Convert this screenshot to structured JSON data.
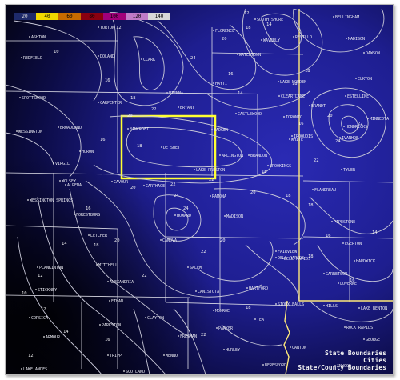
{
  "legend": {
    "ticks": [
      "20",
      "40",
      "60",
      "80",
      "100",
      "120",
      "140"
    ],
    "colors": [
      "#1e2a6a",
      "#f0d800",
      "#c86a00",
      "#8a0010",
      "#a0007a",
      "#c07cc8",
      "#d8d8d8"
    ]
  },
  "map": {
    "background_gradient": [
      "#050510",
      "#0a0a3a",
      "#1d1d8c",
      "#2a2ab0"
    ],
    "contour_color": "#c8c8d8",
    "county_line_color": "#e6e6e6",
    "state_line_color": "#ffe97a",
    "highlight_box_color": "#ffff33"
  },
  "places": [
    {
      "name": "TURTON"
    },
    {
      "name": "ASHTON"
    },
    {
      "name": "REDFIELD"
    },
    {
      "name": "DOLAND"
    },
    {
      "name": "CLARK"
    },
    {
      "name": "FLORENCE"
    },
    {
      "name": "SOUTH SHORE"
    },
    {
      "name": "WAVERLY"
    },
    {
      "name": "REVILLO"
    },
    {
      "name": "BELLINGHAM"
    },
    {
      "name": "MADISON"
    },
    {
      "name": "DAWSON"
    },
    {
      "name": "WATERTOWN"
    },
    {
      "name": "LAKE NORDEN"
    },
    {
      "name": "CARPENTER"
    },
    {
      "name": "BRYANT"
    },
    {
      "name": "VIENNA"
    },
    {
      "name": "HAYTI"
    },
    {
      "name": "CASTLEWOOD"
    },
    {
      "name": "CLEAR LAKE"
    },
    {
      "name": "BRANDT"
    },
    {
      "name": "TORONTO"
    },
    {
      "name": "ESTELLINE"
    },
    {
      "name": "HENDRICKS"
    },
    {
      "name": "MINNEOTA"
    },
    {
      "name": "IVANHOE"
    },
    {
      "name": "TYLER"
    },
    {
      "name": "SPOTTSWOOD"
    },
    {
      "name": "WESSINGTON"
    },
    {
      "name": "BROADLAND"
    },
    {
      "name": "HURON"
    },
    {
      "name": "VIRGIL"
    },
    {
      "name": "BANCROFT"
    },
    {
      "name": "DE SMET"
    },
    {
      "name": "BADGER"
    },
    {
      "name": "ARLINGTON"
    },
    {
      "name": "WHITE"
    },
    {
      "name": "BROOKINGS"
    },
    {
      "name": "IROQUOIS"
    },
    {
      "name": "LAKE PRESTON"
    },
    {
      "name": "WOLSEY"
    },
    {
      "name": "CAVOUR"
    },
    {
      "name": "ALPENA"
    },
    {
      "name": "WESSINGTON SPRINGS"
    },
    {
      "name": "FORESTBURG"
    },
    {
      "name": "CARTHAGE"
    },
    {
      "name": "RAMONA"
    },
    {
      "name": "HOWARD"
    },
    {
      "name": "MADISON"
    },
    {
      "name": "FLANDREAU"
    },
    {
      "name": "PIPESTONE"
    },
    {
      "name": "LETCHER"
    },
    {
      "name": "CANOVA"
    },
    {
      "name": "EGERTON"
    },
    {
      "name": "FAIRVIEW"
    },
    {
      "name": "HARDWICK"
    },
    {
      "name": "PLANKINTON"
    },
    {
      "name": "MITCHELL"
    },
    {
      "name": "SALEM"
    },
    {
      "name": "DELL RAPIDS"
    },
    {
      "name": "GARRETSON"
    },
    {
      "name": "LUVERNE"
    },
    {
      "name": "STICKNEY"
    },
    {
      "name": "ALEXANDRIA"
    },
    {
      "name": "CANISTOTA"
    },
    {
      "name": "HARTFORD"
    },
    {
      "name": "SIOUX FALLS"
    },
    {
      "name": "ETHAN"
    },
    {
      "name": "MONROE"
    },
    {
      "name": "CORSICA"
    },
    {
      "name": "ARMOUR"
    },
    {
      "name": "PARKSTON"
    },
    {
      "name": "CLAYTON"
    },
    {
      "name": "PARKER"
    },
    {
      "name": "TEA"
    },
    {
      "name": "ROCK RAPIDS"
    },
    {
      "name": "GEORGE"
    },
    {
      "name": "FREEMAN"
    },
    {
      "name": "HURLEY"
    },
    {
      "name": "CANTON"
    },
    {
      "name": "INWOOD"
    },
    {
      "name": "LAKE ANDES"
    },
    {
      "name": "TRIPP"
    },
    {
      "name": "MENNO"
    },
    {
      "name": "SCOTLAND"
    },
    {
      "name": "BERESFORD"
    },
    {
      "name": "HILLS"
    },
    {
      "name": "LAKE BENTON"
    },
    {
      "name": "ELKTON"
    },
    {
      "name": "DELL RAPIDS"
    },
    {
      "name": "BRANDON"
    }
  ],
  "contour_labels": [
    "16",
    "18",
    "20",
    "22",
    "24",
    "20",
    "18",
    "16",
    "14",
    "12",
    "10",
    "18",
    "14",
    "12",
    "14",
    "16",
    "18",
    "20",
    "22",
    "24",
    "22",
    "16",
    "18",
    "18",
    "20",
    "22",
    "24",
    "22",
    "20",
    "18",
    "16",
    "14",
    "12",
    "10",
    "12",
    "14",
    "16",
    "18",
    "20",
    "22",
    "24",
    "22",
    "22",
    "20",
    "18",
    "18",
    "16",
    "14",
    "16",
    "18",
    "12"
  ],
  "layer_list": [
    "State Boundaries",
    "Cities",
    "State/County Boundaries"
  ]
}
